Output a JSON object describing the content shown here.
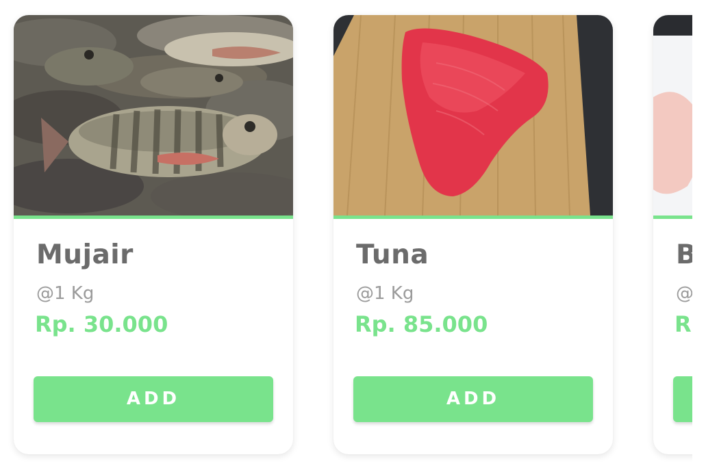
{
  "products": [
    {
      "name": "Mujair",
      "unit": "@1 Kg",
      "price": "Rp. 30.000",
      "button_label": "ADD"
    },
    {
      "name": "Tuna",
      "unit": "@1 Kg",
      "price": "Rp. 85.000",
      "button_label": "ADD"
    },
    {
      "name": "B",
      "unit": "@",
      "price": "R",
      "button_label": ""
    }
  ],
  "colors": {
    "accent": "#79e38c",
    "title": "#6b6b6b",
    "unit": "#9a9a9a",
    "card_bg": "#ffffff"
  },
  "icons": {
    "product_1_image": "tilapia-fish-photo",
    "product_2_image": "tuna-steak-photo",
    "product_3_image": "fish-fillet-photo"
  }
}
